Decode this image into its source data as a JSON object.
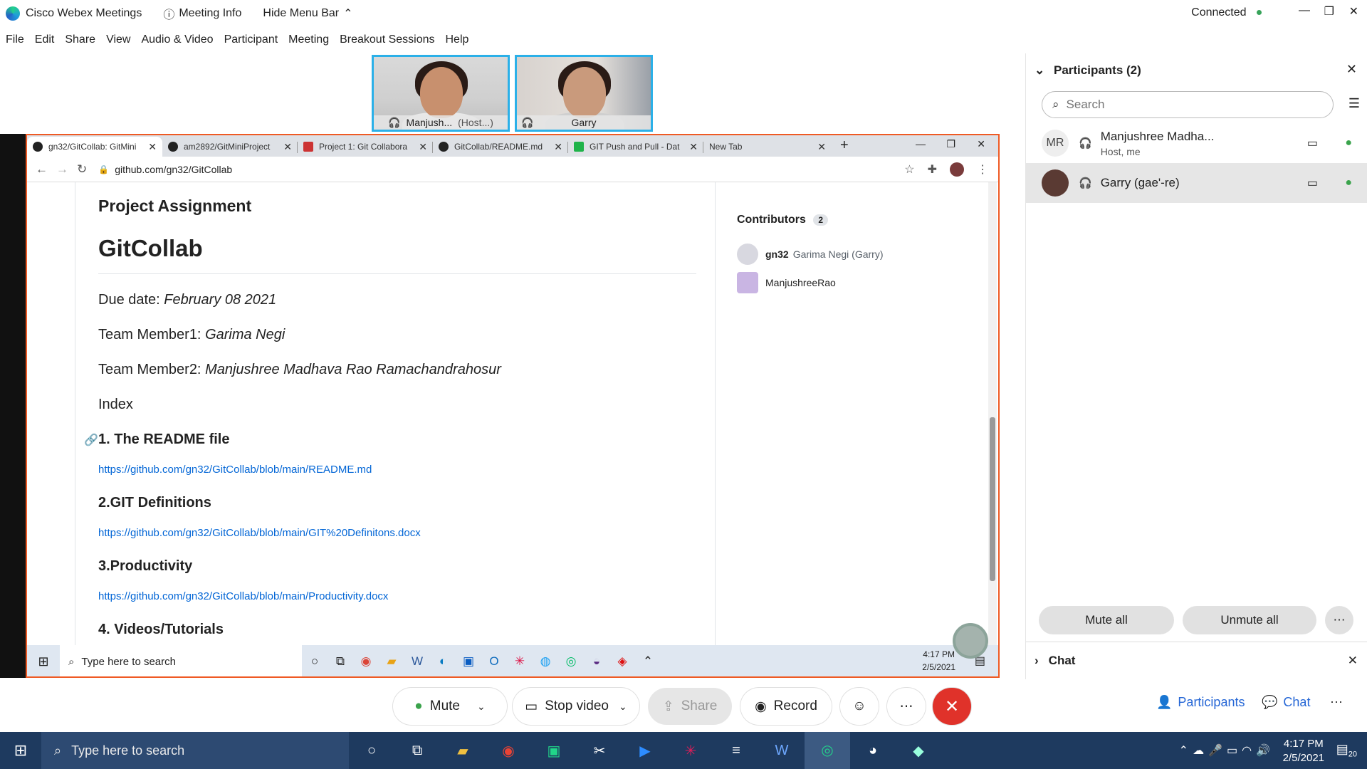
{
  "webex": {
    "app_title": "Cisco Webex Meetings",
    "meeting_info": "Meeting Info",
    "hide_menu": "Hide Menu Bar",
    "connection_status": "Connected",
    "menu": [
      "File",
      "Edit",
      "Share",
      "View",
      "Audio & Video",
      "Participant",
      "Meeting",
      "Breakout Sessions",
      "Help"
    ],
    "video_tiles": [
      {
        "name": "Manjush...",
        "role": "(Host...)"
      },
      {
        "name": "Garry"
      }
    ]
  },
  "browser": {
    "tabs": [
      {
        "title": "gn32/GitCollab: GitMini",
        "active": true
      },
      {
        "title": "am2892/GitMiniProject"
      },
      {
        "title": "Project 1: Git Collabora"
      },
      {
        "title": "GitCollab/README.md"
      },
      {
        "title": "GIT Push and Pull - Dat"
      },
      {
        "title": "New Tab"
      }
    ],
    "url": "github.com/gn32/GitCollab",
    "readme": {
      "project_heading": "Project Assignment",
      "title": "GitCollab",
      "due_label": "Due date: ",
      "due_value": "February 08 2021",
      "member1_label": "Team Member1: ",
      "member1_value": "Garima Negi",
      "member2_label": "Team Member2: ",
      "member2_value": "Manjushree Madhava Rao Ramachandrahosur",
      "index_label": "Index",
      "sections": [
        {
          "heading": "1. The README file",
          "link": "https://github.com/gn32/GitCollab/blob/main/README.md"
        },
        {
          "heading": "2.GIT Definitions",
          "link": "https://github.com/gn32/GitCollab/blob/main/GIT%20Definitons.docx"
        },
        {
          "heading": "3.Productivity",
          "link": "https://github.com/gn32/GitCollab/blob/main/Productivity.docx"
        },
        {
          "heading": "4. Videos/Tutorials"
        }
      ]
    },
    "sidebar": {
      "contributors_label": "Contributors",
      "contributors_count": "2",
      "contributors": [
        {
          "login": "gn32",
          "name": "Garima Negi (Garry)"
        },
        {
          "login": "ManjushreeRao",
          "name": ""
        }
      ]
    },
    "inner_taskbar": {
      "search_placeholder": "Type here to search",
      "time": "4:17 PM",
      "date": "2/5/2021"
    }
  },
  "participants_panel": {
    "title": "Participants (2)",
    "search_placeholder": "Search",
    "people": [
      {
        "initials": "MR",
        "name": "Manjushree Madha...",
        "sub": "Host, me"
      },
      {
        "initials": "",
        "name": "Garry (gae'-re)",
        "sub": ""
      }
    ],
    "mute_all": "Mute all",
    "unmute_all": "Unmute all",
    "chat_label": "Chat"
  },
  "controls": {
    "mute": "Mute",
    "stop_video": "Stop video",
    "share": "Share",
    "record": "Record",
    "participants": "Participants",
    "chat": "Chat"
  },
  "taskbar": {
    "search_placeholder": "Type here to search",
    "time": "4:17 PM",
    "date": "2/5/2021",
    "notif_count": "20"
  },
  "colors": {
    "share_border": "#ef5a24",
    "end_button": "#e0322a",
    "link": "#0366d6",
    "tile_border": "#2bb0e8"
  }
}
